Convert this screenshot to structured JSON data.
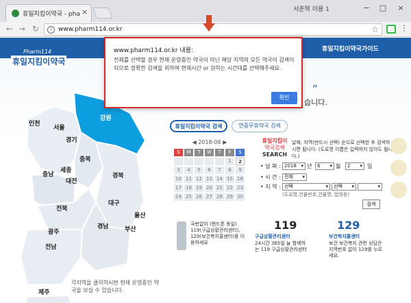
{
  "browser": {
    "tab_title": "휴일지킴이약국 - pharm",
    "tab_close": "×",
    "profile": "서준혁 이용 1",
    "minimize": "−",
    "maximize": "□",
    "close": "×",
    "url": "www.pharm114.or.kr",
    "star": "☆",
    "menu": "⋮",
    "info": "i",
    "back": "←",
    "forward": "→",
    "reload": "↻"
  },
  "site": {
    "logo_sub": "Pharm114",
    "logo_main": "휴일지킴이약국",
    "guide_link": "휴일지킴이약국가이드",
    "hero_line1": "”",
    "hero_line2": "습니다.",
    "regions": [
      "강원",
      "인천",
      "서울",
      "경기",
      "충북",
      "충남",
      "세종",
      "대전",
      "경북",
      "대구",
      "전북",
      "울산",
      "광주",
      "경남",
      "부산",
      "전남",
      "제주"
    ],
    "map_hint": "각지역을 클릭하시면 현재 운영중인 약국을 보실 수 있습니다."
  },
  "search": {
    "tab_active": "휴일지킴이약국 검색",
    "tab_inactive": "연중무휴약국 검색",
    "calendar_header": "◀ 2018-06 ▶",
    "dow": [
      "S",
      "M",
      "T",
      "W",
      "T",
      "F",
      "S"
    ],
    "days": [
      "",
      "",
      "",
      "",
      "",
      "1",
      "2",
      "3",
      "4",
      "5",
      "6",
      "7",
      "8",
      "9",
      "10",
      "11",
      "12",
      "13",
      "14",
      "15",
      "16",
      "17",
      "18",
      "19",
      "20",
      "21",
      "22",
      "23",
      "24",
      "25",
      "26",
      "27",
      "28",
      "29",
      "30"
    ],
    "search_title_line1": "휴일지킴이",
    "search_title_line2": "약국검색",
    "search_title_line3": "SEARCH",
    "desc": "날짜, 지역(반드시 선택) 순으로 선택한 후 검색하시면 됩니다. (도로명 이름은 입력하지 않아도 됩니다.)",
    "date_label": "• 날 짜 :",
    "year": "2018",
    "year_unit": "년",
    "month": "6",
    "month_unit": "월",
    "day": "2",
    "day_unit": "일",
    "time_label": "• 시 간 :",
    "time_value": "전체",
    "region_label": "• 지 역 :",
    "region_value1": "선택",
    "region_value2": "선택",
    "region_hint": "(도로명,건물번호,건물명, 법정동)",
    "search_button": "검색"
  },
  "promo": {
    "phone_text": "국번없이 (핸드폰 동일) 119(구급상황관리센터), 129(보건복지콜센터)를 이용하세요",
    "num119": "119",
    "title119": "구급상황관리센터",
    "desc119": "24시간 365일 늘 함께하는 119 구급상황관리센터",
    "num129": "129",
    "title129": "보건복지콜센터",
    "desc129": "보건 보건복지 관련 상담은 지역번호 없이 129를 누르세요."
  },
  "dialog": {
    "title": "www.pharm114.or.kr 내용:",
    "message": "전체를 선택할 경우 현재 운영중인 약국이 아닌 해당 지역의 모든 약국이 검색이 되므로 정확한 검색을 위하여 현재시간 or 원하는 시간대를 선택해주세요.",
    "ok": "확인"
  },
  "colors": {
    "brand_blue": "#1f5ea8",
    "dialog_border": "#d52b2b",
    "ok_button": "#3b7be0",
    "arrow": "#d6492c",
    "gangwon": "#0d9ee0"
  }
}
